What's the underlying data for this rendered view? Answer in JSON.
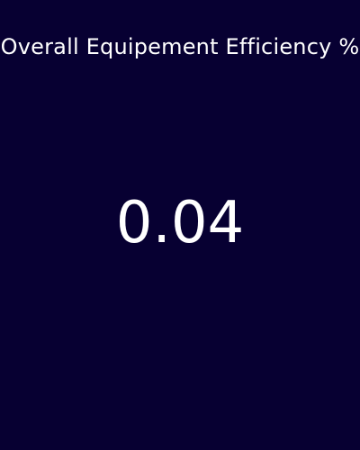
{
  "kpi": {
    "title": "Overall Equipement Efficiency %",
    "value": "0.04"
  },
  "colors": {
    "background": "#070032",
    "text": "#ffffff"
  }
}
